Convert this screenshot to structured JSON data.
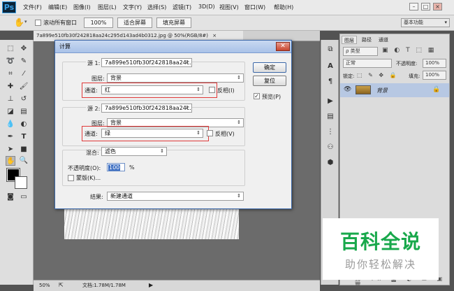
{
  "menubar": {
    "logo": "Ps",
    "items": [
      "文件(F)",
      "编辑(E)",
      "图像(I)",
      "图层(L)",
      "文字(Y)",
      "选择(S)",
      "滤镜(T)",
      "3D(D)",
      "视图(V)",
      "窗口(W)",
      "帮助(H)"
    ],
    "window_buttons": [
      "–",
      "□",
      "×"
    ]
  },
  "options_bar": {
    "scroll_all_label": "滚动所有窗口",
    "zoom_value": "100%",
    "fit_screen_label": "适合屏幕",
    "fill_screen_label": "填充屏幕",
    "workspace": "基本功能"
  },
  "document": {
    "tab_title": "7a899e510fb30f242818aa24c295d143ad4b0312.jpg @ 50%(RGB/8#)",
    "close": "×"
  },
  "status_bar": {
    "zoom": "50%",
    "doc_info": "文档:1.78M/1.78M"
  },
  "dialog": {
    "title": "计算",
    "close": "✕",
    "source1": {
      "label": "源 1:",
      "file": "7a899e510fb30f242818aa24c...",
      "layer_label": "图层:",
      "layer": "背景",
      "channel_label": "通道:",
      "channel": "红",
      "invert_label": "反相(I)",
      "invert_checked": false
    },
    "source2": {
      "label": "源 2:",
      "file": "7a899e510fb30f242818aa24c...",
      "layer_label": "图层:",
      "layer": "背景",
      "channel_label": "通道:",
      "channel": "绿",
      "invert_label": "反相(V)",
      "invert_checked": false
    },
    "blending": {
      "label": "混合:",
      "mode": "滤色",
      "opacity_label": "不透明度(O):",
      "opacity": "100",
      "opacity_unit": "%",
      "mask_label": "蒙版(K)...",
      "mask_checked": false
    },
    "result": {
      "label": "结果:",
      "value": "新建通道"
    },
    "ok_label": "确定",
    "reset_label": "复位",
    "preview_label": "预览(P)",
    "preview_checked": true
  },
  "layers_panel": {
    "tabs": [
      "图层",
      "路径",
      "通道"
    ],
    "filter_kind": "ρ 类型",
    "blend_mode": "正常",
    "opacity_label": "不透明度:",
    "opacity_value": "100%",
    "lock_label": "锁定:",
    "fill_label": "填充:",
    "fill_value": "100%",
    "layer_name": "背景"
  },
  "watermark": {
    "title": "百科全说",
    "subtitle": "助你轻松解决"
  }
}
